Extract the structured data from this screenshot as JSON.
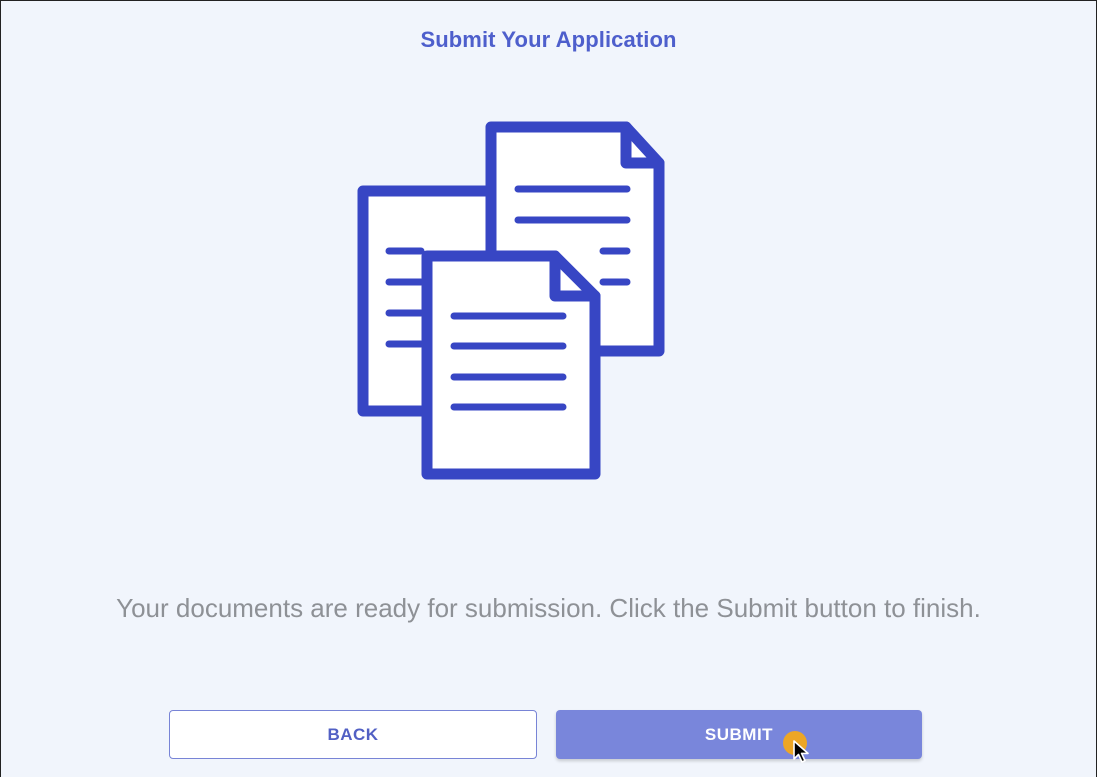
{
  "page": {
    "title": "Submit Your Application",
    "message": "Your documents are ready for submission. Click the Submit button to finish."
  },
  "illustration": {
    "icon": "documents-icon",
    "color": "#3746c4"
  },
  "buttons": {
    "back_label": "BACK",
    "submit_label": "SUBMIT"
  },
  "colors": {
    "accent": "#4e5fcc",
    "submit_bg": "#7986db",
    "background": "#f1f5fc",
    "cursor_highlight": "#f3a81b"
  }
}
